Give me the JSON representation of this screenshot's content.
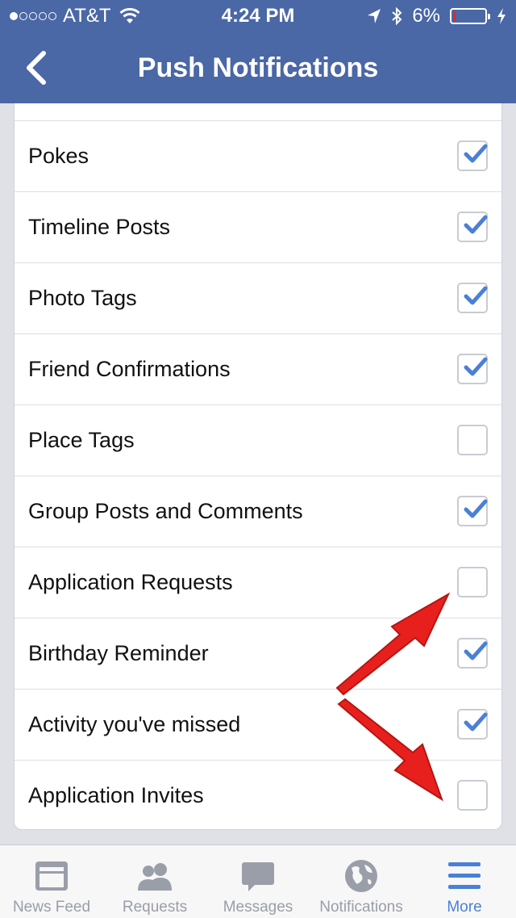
{
  "status_bar": {
    "carrier": "AT&T",
    "signal_filled": 1,
    "signal_total": 5,
    "time": "4:24 PM",
    "battery": "6%",
    "battery_level": 0.06,
    "battery_color": "#e2262b"
  },
  "nav": {
    "title": "Push Notifications",
    "back_icon": "chevron-left-icon"
  },
  "settings": [
    {
      "label": "Pokes",
      "checked": true
    },
    {
      "label": "Timeline Posts",
      "checked": true
    },
    {
      "label": "Photo Tags",
      "checked": true
    },
    {
      "label": "Friend Confirmations",
      "checked": true
    },
    {
      "label": "Place Tags",
      "checked": false
    },
    {
      "label": "Group Posts and Comments",
      "checked": true
    },
    {
      "label": "Application Requests",
      "checked": false
    },
    {
      "label": "Birthday Reminder",
      "checked": true
    },
    {
      "label": "Activity you've missed",
      "checked": true
    },
    {
      "label": "Application Invites",
      "checked": false
    }
  ],
  "tabs": [
    {
      "label": "News Feed",
      "icon": "news-feed-icon",
      "active": false
    },
    {
      "label": "Requests",
      "icon": "friends-icon",
      "active": false
    },
    {
      "label": "Messages",
      "icon": "chat-bubble-icon",
      "active": false
    },
    {
      "label": "Notifications",
      "icon": "globe-icon",
      "active": false
    },
    {
      "label": "More",
      "icon": "menu-icon",
      "active": true
    }
  ],
  "colors": {
    "brand": "#4a67a6",
    "check": "#4a80d6",
    "active_tab": "#4a80d6",
    "annotation_arrow": "#e8201d"
  }
}
